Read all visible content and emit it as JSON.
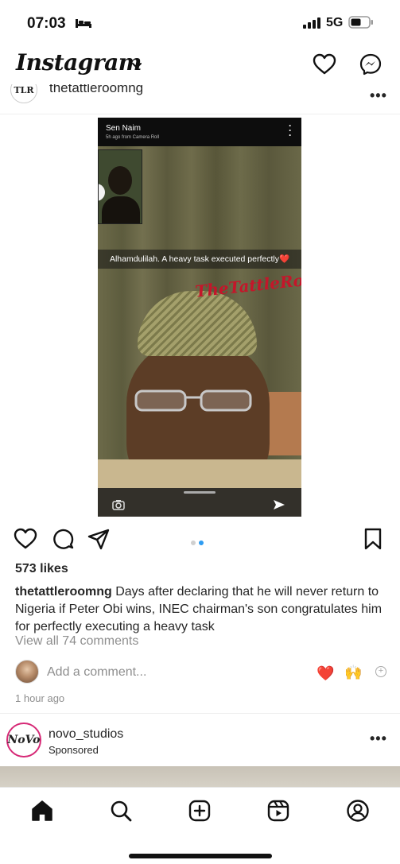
{
  "status_bar": {
    "time": "07:03",
    "network": "5G"
  },
  "header": {
    "logo_text": "Instagram"
  },
  "post": {
    "username": "thetattleroomng",
    "avatar_text": "TLR",
    "media": {
      "screenshot_sender": "Sen Naim",
      "screenshot_subtitle": "5h ago from Camera Roll",
      "screenshot_caption": "Alhamdulilah. A heavy task executed perfectly❤️",
      "watermark": "TheTattleRoomNg"
    },
    "carousel": {
      "count": 2,
      "active_index": 1
    },
    "likes": "573 likes",
    "caption_username": "thetattleroomng",
    "caption_text": " Days after declaring that he will never return to Nigeria if Peter Obi wins, INEC chairman's son congratulates him for perfectly executing a heavy task",
    "view_comments": "View all 74 comments",
    "add_comment_placeholder": "Add a comment...",
    "quick_reactions": [
      "❤️",
      "🙌"
    ],
    "timestamp": "1 hour ago"
  },
  "sponsored_post": {
    "username": "novo_studios",
    "label": "Sponsored",
    "avatar_text": "NoVo"
  },
  "bottom_nav": {
    "items": [
      "home-icon",
      "search-icon",
      "create-icon",
      "reels-icon",
      "profile-icon"
    ]
  },
  "colors": {
    "accent_blue": "#2e9cf2",
    "like_red": "#e0245e",
    "watermark_red": "#c4162a",
    "muted_text": "#8e8e8e"
  }
}
